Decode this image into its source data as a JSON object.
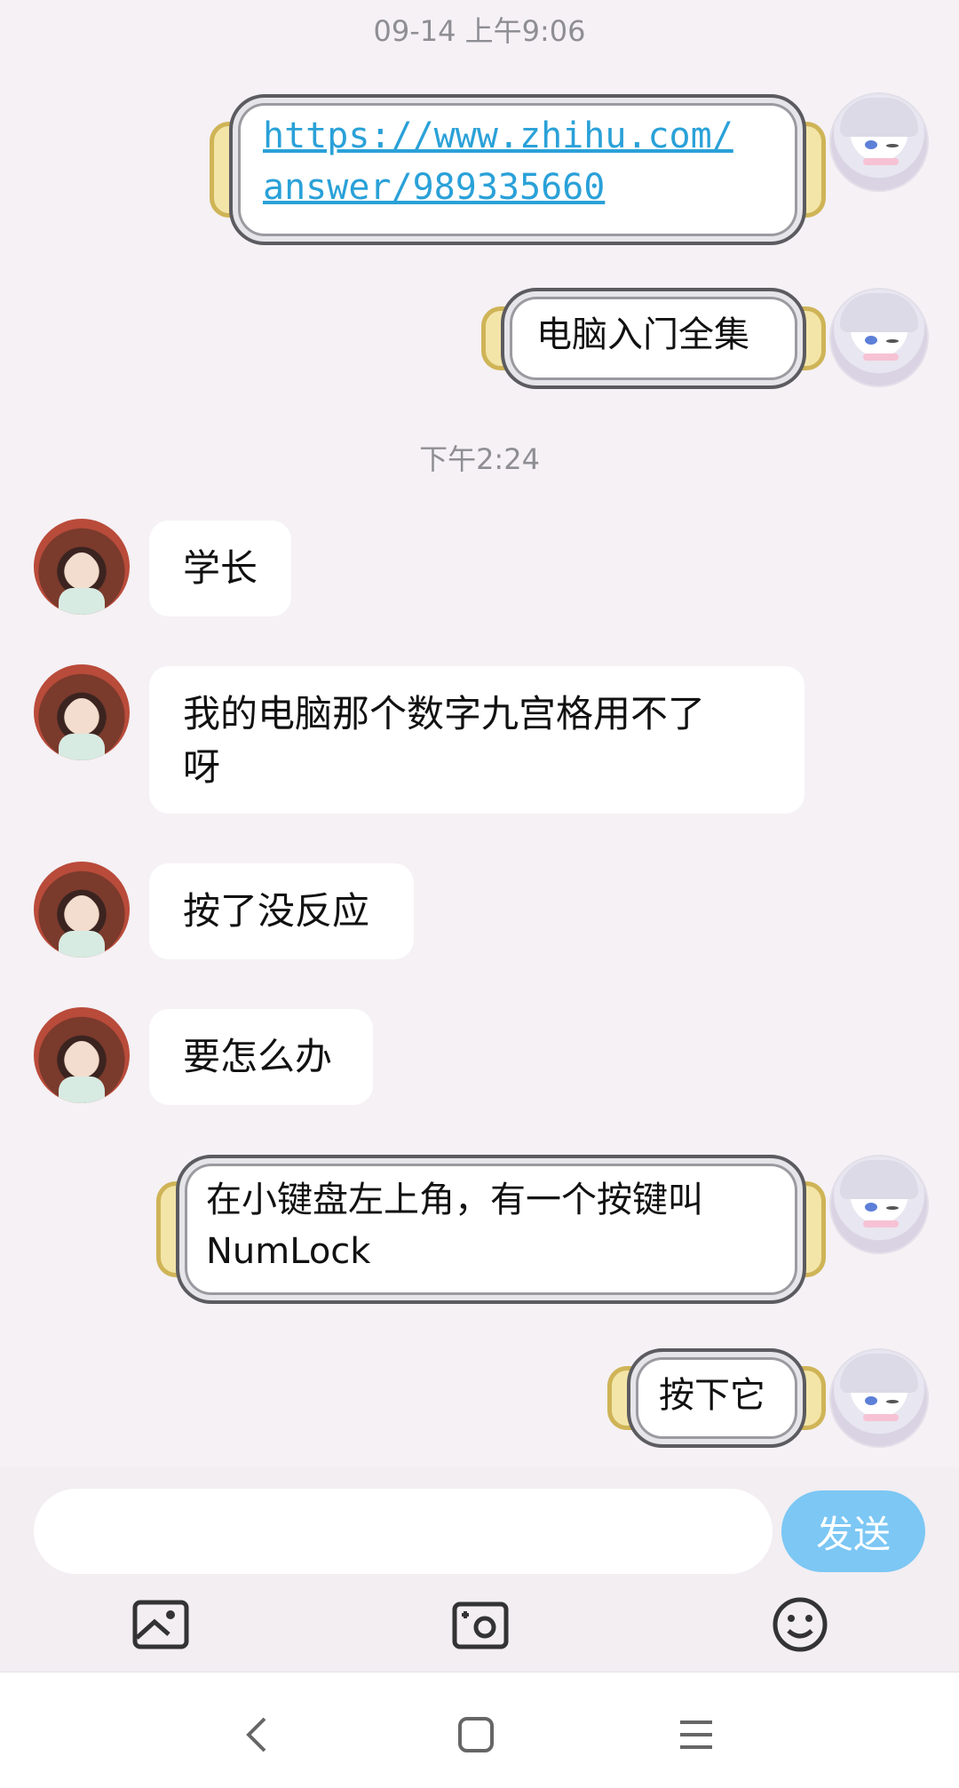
{
  "timestamps": {
    "first": "09-14 上午9:06",
    "second": "下午2:24"
  },
  "messages": [
    {
      "id": "m1",
      "side": "out",
      "text": "https://www.zhihu.com/answer/989335660",
      "line1": "https://www.zhihu.com/",
      "line2": "answer/989335660"
    },
    {
      "id": "m2",
      "side": "out",
      "text": "电脑入门全集"
    },
    {
      "id": "m3",
      "side": "in",
      "text": "学长"
    },
    {
      "id": "m4",
      "side": "in",
      "text": "我的电脑那个数字九宫格用不了呀",
      "line1": "我的电脑那个数字九宫格用不了",
      "line2": "呀"
    },
    {
      "id": "m5",
      "side": "in",
      "text": "按了没反应"
    },
    {
      "id": "m6",
      "side": "in",
      "text": "要怎么办"
    },
    {
      "id": "m7",
      "side": "out",
      "text": "在小键盘左上角，有一个按键叫NumLock",
      "line1": "在小键盘左上角，有一个按键叫",
      "line2": "NumLock"
    },
    {
      "id": "m8",
      "side": "out",
      "text": "按下它"
    }
  ],
  "composer": {
    "input_value": "",
    "send_label": "发送"
  },
  "toolbar": {
    "icons": [
      "image-icon",
      "camera-icon",
      "emoji-icon"
    ]
  },
  "system_nav": {
    "icons": [
      "back-icon",
      "home-icon",
      "menu-icon"
    ]
  },
  "colors": {
    "background": "#f5f1f5",
    "link": "#2aa1d8",
    "send_button": "#7cc7f4",
    "timestamp": "#8e8e93"
  }
}
